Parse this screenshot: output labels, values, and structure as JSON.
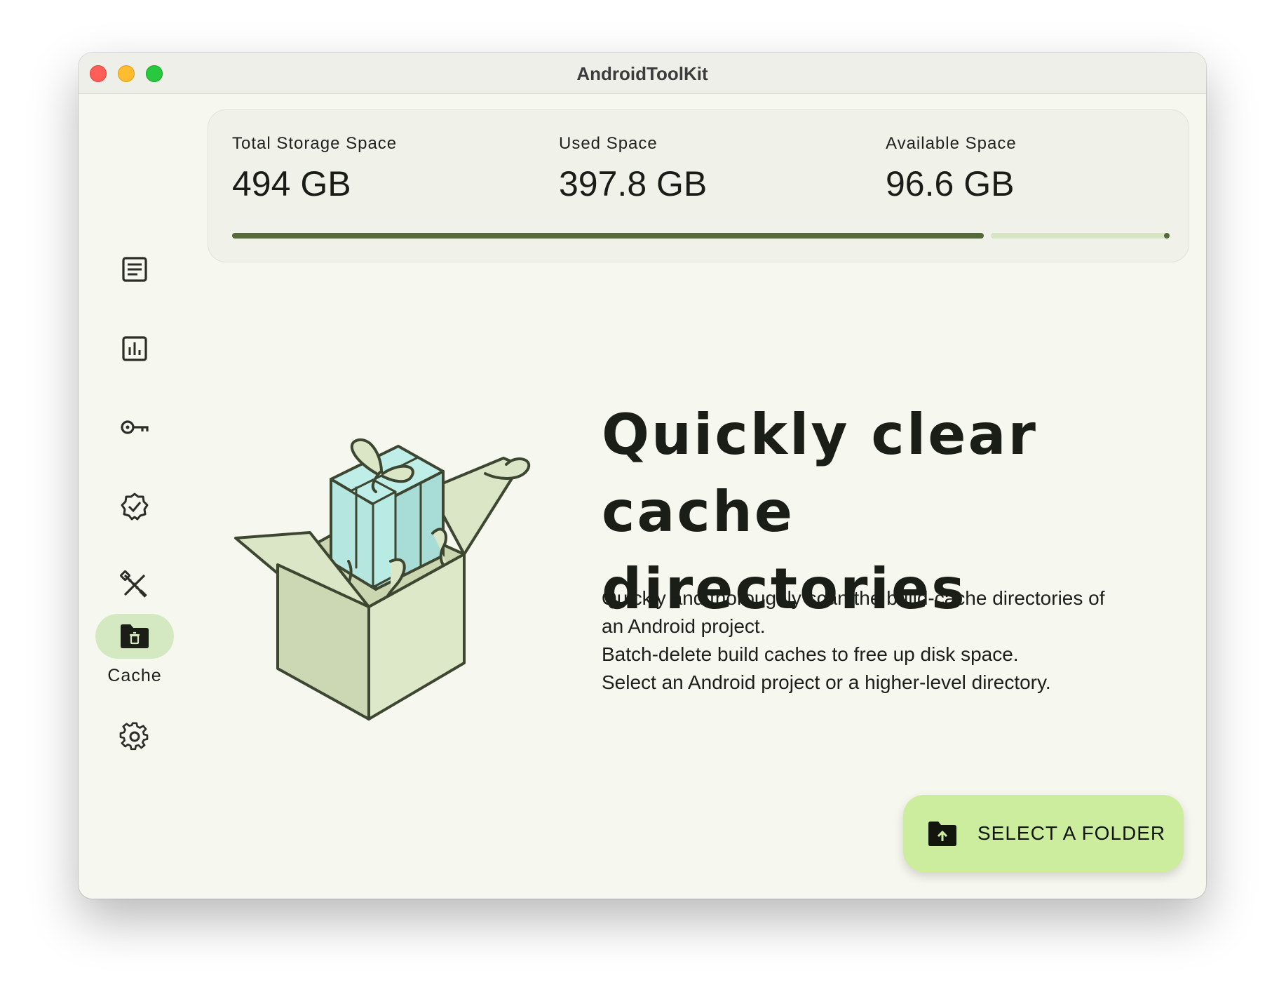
{
  "window": {
    "title": "AndroidToolKit"
  },
  "sidebar": {
    "items": [
      {
        "icon": "document-icon",
        "label": ""
      },
      {
        "icon": "chart-icon",
        "label": ""
      },
      {
        "icon": "key-icon",
        "label": ""
      },
      {
        "icon": "verified-badge-icon",
        "label": ""
      },
      {
        "icon": "tools-icon",
        "label": ""
      },
      {
        "icon": "folder-delete-icon",
        "label": "Cache",
        "selected": true
      },
      {
        "icon": "gear-icon",
        "label": ""
      }
    ]
  },
  "storage": {
    "total_label": "Total Storage Space",
    "total_value": "494 GB",
    "used_label": "Used Space",
    "used_value": "397.8 GB",
    "available_label": "Available Space",
    "available_value": "96.6 GB",
    "used_fraction": 0.805
  },
  "main": {
    "headline_line1": "Quickly clear",
    "headline_line2": "cache directories",
    "description": [
      "Quickly and thoroughly scan the build-cache directories of",
      "an Android project.",
      "Batch-delete build caches to free up disk space.",
      "Select an Android project or a higher-level directory."
    ],
    "select_button_label": "SELECT A FOLDER"
  },
  "colors": {
    "accent": "#55693a",
    "accent_light": "#ccec9e",
    "nav_active": "#d4e9c2",
    "background": "#f6f7ee"
  }
}
